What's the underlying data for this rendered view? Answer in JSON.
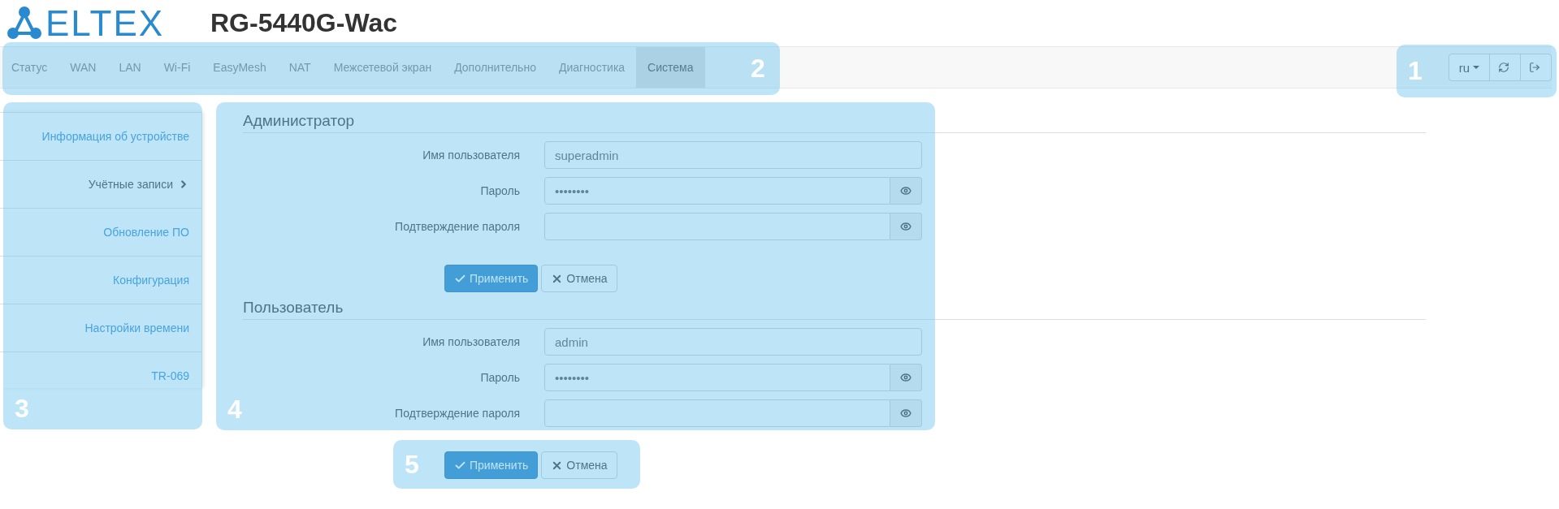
{
  "header": {
    "logo_text": "ELTEX",
    "title": "RG-5440G-Wac"
  },
  "nav": {
    "tabs": [
      {
        "label": "Статус",
        "selected": false
      },
      {
        "label": "WAN",
        "selected": false
      },
      {
        "label": "LAN",
        "selected": false
      },
      {
        "label": "Wi-Fi",
        "selected": false
      },
      {
        "label": "EasyMesh",
        "selected": false
      },
      {
        "label": "NAT",
        "selected": false
      },
      {
        "label": "Межсетевой экран",
        "selected": false
      },
      {
        "label": "Дополнительно",
        "selected": false
      },
      {
        "label": "Диагностика",
        "selected": false
      },
      {
        "label": "Система",
        "selected": true
      }
    ],
    "language": "ru"
  },
  "sidebar": {
    "items": [
      {
        "label": "Информация об устройстве",
        "selected": false
      },
      {
        "label": "Учётные записи",
        "selected": true
      },
      {
        "label": "Обновление ПО",
        "selected": false
      },
      {
        "label": "Конфигурация",
        "selected": false
      },
      {
        "label": "Настройки времени",
        "selected": false
      },
      {
        "label": "TR-069",
        "selected": false
      }
    ]
  },
  "sections": [
    {
      "title": "Администратор",
      "fields": [
        {
          "kind": "text",
          "label": "Имя пользователя",
          "value": "superadmin"
        },
        {
          "kind": "password",
          "label": "Пароль",
          "value": "••••••••"
        },
        {
          "kind": "password",
          "label": "Подтверждение пароля"
        }
      ],
      "buttons": [
        {
          "kind": "apply",
          "label": "Применить"
        },
        {
          "kind": "cancel",
          "label": "Отмена"
        }
      ]
    },
    {
      "title": "Пользователь",
      "fields": [
        {
          "kind": "text",
          "label": "Имя пользователя",
          "value": "admin"
        },
        {
          "kind": "password",
          "label": "Пароль",
          "value": "••••••••"
        },
        {
          "kind": "password",
          "label": "Подтверждение пароля"
        }
      ],
      "buttons": [
        {
          "kind": "apply",
          "label": "Применить"
        },
        {
          "kind": "cancel",
          "label": "Отмена"
        }
      ]
    }
  ],
  "callouts": [
    {
      "number": "1"
    },
    {
      "number": "2"
    },
    {
      "number": "3"
    },
    {
      "number": "4"
    },
    {
      "number": "5"
    }
  ]
}
